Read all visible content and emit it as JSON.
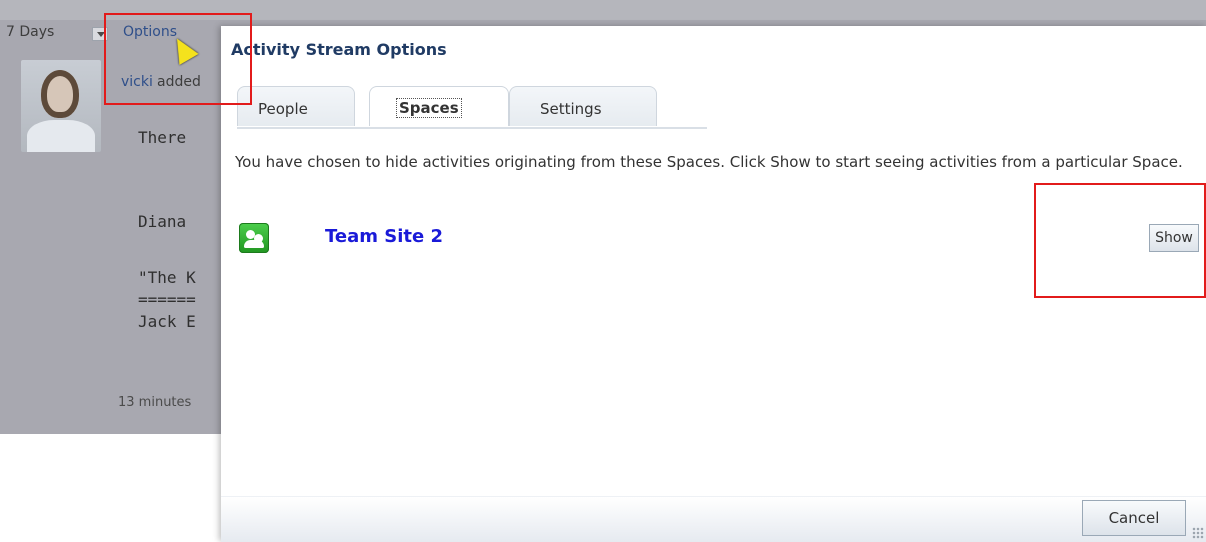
{
  "background": {
    "days_label": "7 Days",
    "options_label": "Options",
    "user": "vicki",
    "action": "added",
    "lines": [
      "There",
      "Diana",
      "\"The K",
      "======",
      "Jack E"
    ],
    "time": "13 minutes"
  },
  "dialog": {
    "title": "Activity Stream Options",
    "tabs": [
      {
        "label": "People",
        "active": false
      },
      {
        "label": "Spaces",
        "active": true
      },
      {
        "label": "Settings",
        "active": false
      }
    ],
    "description": "You have chosen to hide activities originating from these Spaces. Click Show to start seeing activities from a particular Space.",
    "spaces": [
      {
        "name": "Team Site 2",
        "icon": "team-space-icon",
        "action_label": "Show"
      }
    ],
    "cancel_label": "Cancel"
  },
  "colors": {
    "highlight": "#e21b1b",
    "link": "#1a1ad8",
    "title": "#203b64"
  }
}
